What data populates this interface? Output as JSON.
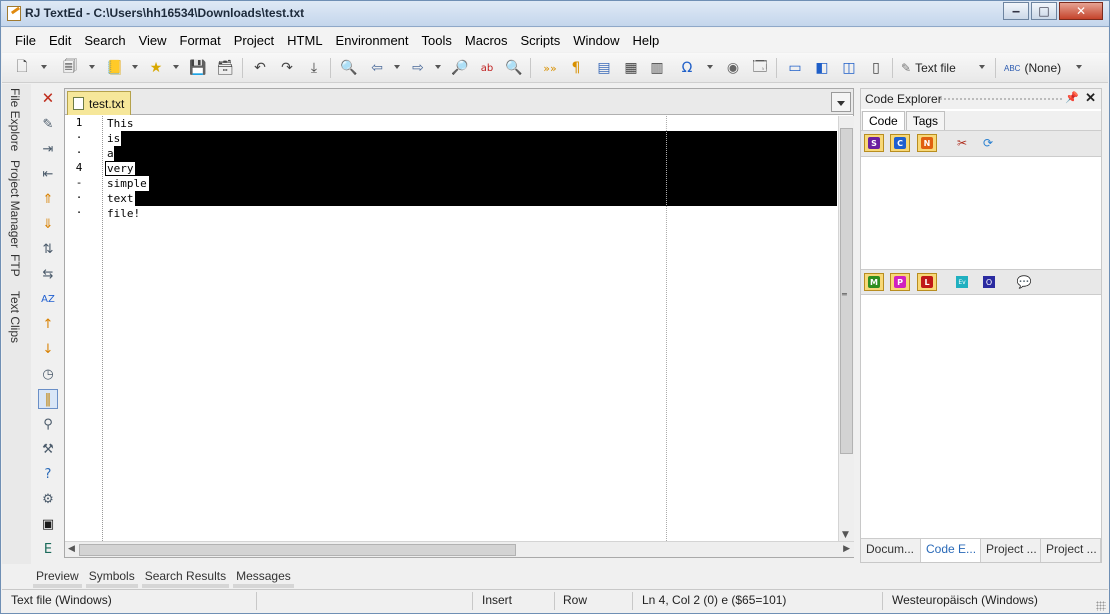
{
  "window": {
    "title": "RJ TextEd - C:\\Users\\hh16534\\Downloads\\test.txt",
    "min_label": "‒",
    "max_label": "□",
    "close_label": "✕"
  },
  "menu": [
    {
      "label": "File"
    },
    {
      "label": "Edit"
    },
    {
      "label": "Search"
    },
    {
      "label": "View"
    },
    {
      "label": "Format"
    },
    {
      "label": "Project"
    },
    {
      "label": "HTML"
    },
    {
      "label": "Environment"
    },
    {
      "label": "Tools"
    },
    {
      "label": "Macros"
    },
    {
      "label": "Scripts"
    },
    {
      "label": "Window"
    },
    {
      "label": "Help"
    }
  ],
  "toolbar": {
    "text_file_label": "Text file",
    "spell_label": "(None)"
  },
  "left_tabs": {
    "file_explorer": "File Explore",
    "project_manager": "Project Manager",
    "ftp": "FTP",
    "text_clips": "Text Clips"
  },
  "editor": {
    "tab_label": "test.txt",
    "line_numbers": [
      "1",
      "·",
      "·",
      "4",
      "-",
      "·",
      "·"
    ],
    "lines": [
      "This",
      "is",
      "a",
      "very",
      "simple",
      "text",
      "file!"
    ],
    "cursor": {
      "line": 4,
      "col": 2
    }
  },
  "bottom_tabs": [
    "Preview",
    "Symbols",
    "Search Results",
    "Messages"
  ],
  "code_explorer": {
    "title": "Code Explorer",
    "tabs": [
      "Code",
      "Tags"
    ],
    "filter_buttons": [
      {
        "letter": "S",
        "color": "#6a1fa0"
      },
      {
        "letter": "C",
        "color": "#1f5fd0"
      },
      {
        "letter": "N",
        "color": "#e06010"
      }
    ],
    "filter_buttons2": [
      {
        "letter": "M",
        "color": "#2f8f1f"
      },
      {
        "letter": "P",
        "color": "#d020c0"
      },
      {
        "letter": "L",
        "color": "#c01818"
      },
      {
        "letter": "Ev",
        "color": "#20b0c0"
      },
      {
        "letter": "O",
        "color": "#2a2aa0"
      }
    ],
    "panel_tabs": [
      "Docum...",
      "Code E...",
      "Project ...",
      "Project ..."
    ]
  },
  "status": {
    "file_type": "Text file (Windows)",
    "mode": "Insert",
    "row": "Row",
    "position": "Ln 4, Col 2 (0) e ($65=101)",
    "encoding": "Westeuropäisch (Windows)"
  }
}
